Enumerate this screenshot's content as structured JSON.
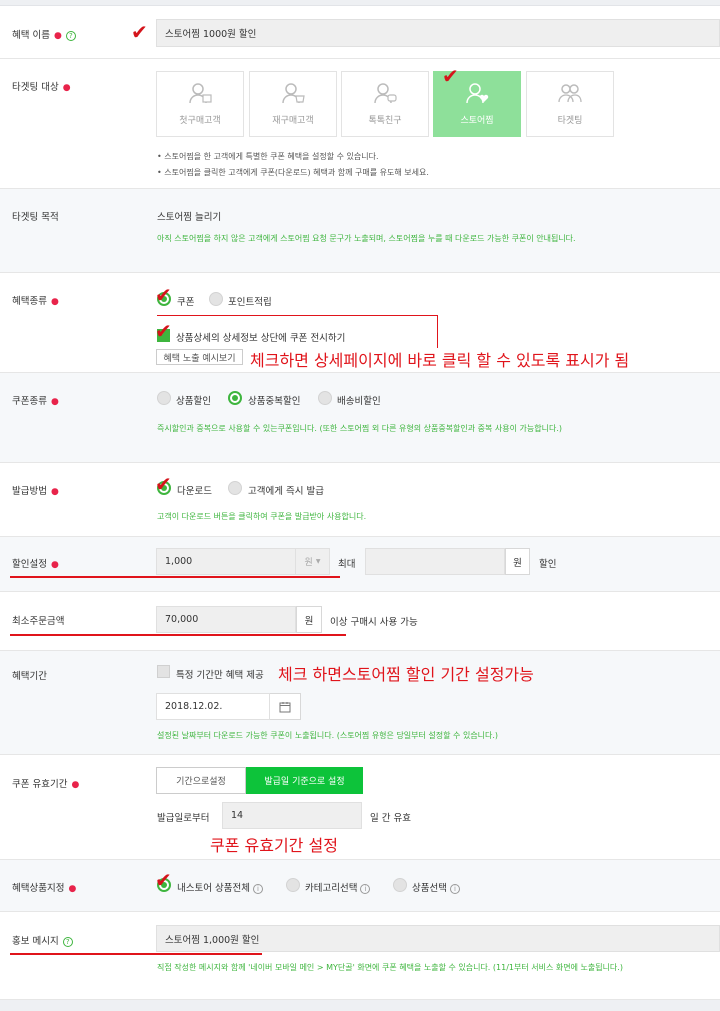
{
  "benefit_name": {
    "label": "혜택 이름",
    "value": "스토어찜 1000원 할인"
  },
  "targeting": {
    "label": "타겟팅 대상",
    "cards": [
      {
        "label": "첫구매고객",
        "icon": "first-buyer-icon"
      },
      {
        "label": "재구매고객",
        "icon": "repeat-buyer-icon"
      },
      {
        "label": "톡톡친구",
        "icon": "talk-friend-icon"
      },
      {
        "label": "스토어찜",
        "icon": "store-favorite-icon"
      },
      {
        "label": "타겟팅",
        "icon": "targeting-group-icon"
      }
    ],
    "notes": [
      "• 스토어찜을 한 고객에게 특별한 쿠폰 혜택을 설정할 수 있습니다.",
      "• 스토어찜을 클릭한 고객에게 쿠폰(다운로드) 혜택과 함께 구매를 유도해 보세요."
    ]
  },
  "purpose": {
    "label": "타겟팅 목적",
    "value": "스토어찜 늘리기",
    "note": "아직 스토어찜을 하지 않은 고객에게 스토어찜 요청 문구가 노출되며, 스토어찜을 누를 때 다운로드 가능한 쿠폰이 안내됩니다."
  },
  "benefit_type": {
    "label": "혜택종류",
    "options": [
      "쿠폰",
      "포인트적립"
    ],
    "show_top": "상품상세의 상세정보 상단에 쿠폰 전시하기",
    "preview_button": "혜택 노출 예시보기",
    "annotation": "체크하면 상세페이지에 바로 클릭 할 수 있도록 표시가 됨"
  },
  "coupon_type": {
    "label": "쿠폰종류",
    "options": [
      "상품할인",
      "상품중복할인",
      "배송비할인"
    ],
    "note": "즉시할인과 중복으로 사용할 수 있는쿠폰입니다. (또한 스토어찜 외 다른 유형의 상품중복할인과 중복 사용이 가능합니다.)"
  },
  "issue_method": {
    "label": "발급방법",
    "options": [
      "다운로드",
      "고객에게 즉시 발급"
    ],
    "note": "고객이 다운로드 버튼을 클릭하여 쿠폰을 발급받아 사용합니다."
  },
  "discount": {
    "label": "할인설정",
    "value": "1,000",
    "unit": "원",
    "max_label": "최대",
    "max_unit": "원",
    "suffix": "할인"
  },
  "min_order": {
    "label": "최소주문금액",
    "value": "70,000",
    "unit": "원",
    "suffix": "이상 구매시 사용 가능"
  },
  "period": {
    "label": "혜택기간",
    "checkbox": "특정 기간만 혜택 제공",
    "annotation": "체크 하면스토어찜 할인 기간 설정가능",
    "date": "2018.12.02.",
    "note": "설정된 날짜부터 다운로드 가능한 쿠폰이 노출됩니다. (스토어찜 유형은 당일부터 설정할 수 있습니다.)"
  },
  "validity": {
    "label": "쿠폰 유효기간",
    "tabs": [
      "기간으로설정",
      "발급일 기준으로 설정"
    ],
    "from_label": "발급일로부터",
    "days": "14",
    "days_suffix": "일 간 유효",
    "annotation": "쿠폰 유효기간 설정"
  },
  "product_scope": {
    "label": "혜택상품지정",
    "options": [
      "내스토어 상품전체",
      "카테고리선택",
      "상품선택"
    ]
  },
  "promo": {
    "label": "홍보 메시지",
    "value": "스토어찜 1,000원 할인",
    "note": "직접 작성한 메시지와 함께 '네이버 모바일 메인 > MY단골' 화면에 쿠폰 혜택을 노출할 수 있습니다. (11/1부터 서비스 화면에 노출됩니다.)"
  },
  "colors": {
    "accent": "#3eb53e",
    "annotation": "#e0141b",
    "selected_card": "#8ee09a"
  }
}
